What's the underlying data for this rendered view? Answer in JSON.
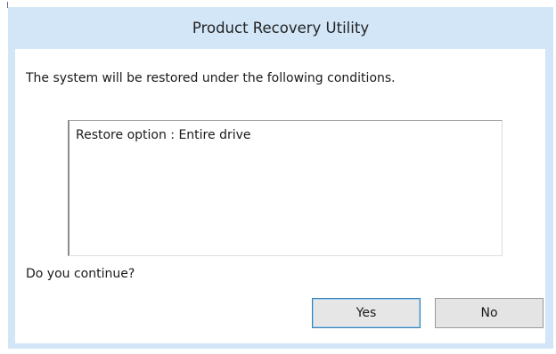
{
  "dialog": {
    "title": "Product Recovery Utility",
    "message": "The system will be restored under the following conditions.",
    "conditions": "Restore option : Entire drive",
    "question": "Do you continue?",
    "buttons": {
      "yes": "Yes",
      "no": "No"
    }
  },
  "colors": {
    "frame": "#d2e6f8",
    "client": "#ffffff",
    "button": "#e4e4e4",
    "focus_border": "#3c7fb1"
  }
}
